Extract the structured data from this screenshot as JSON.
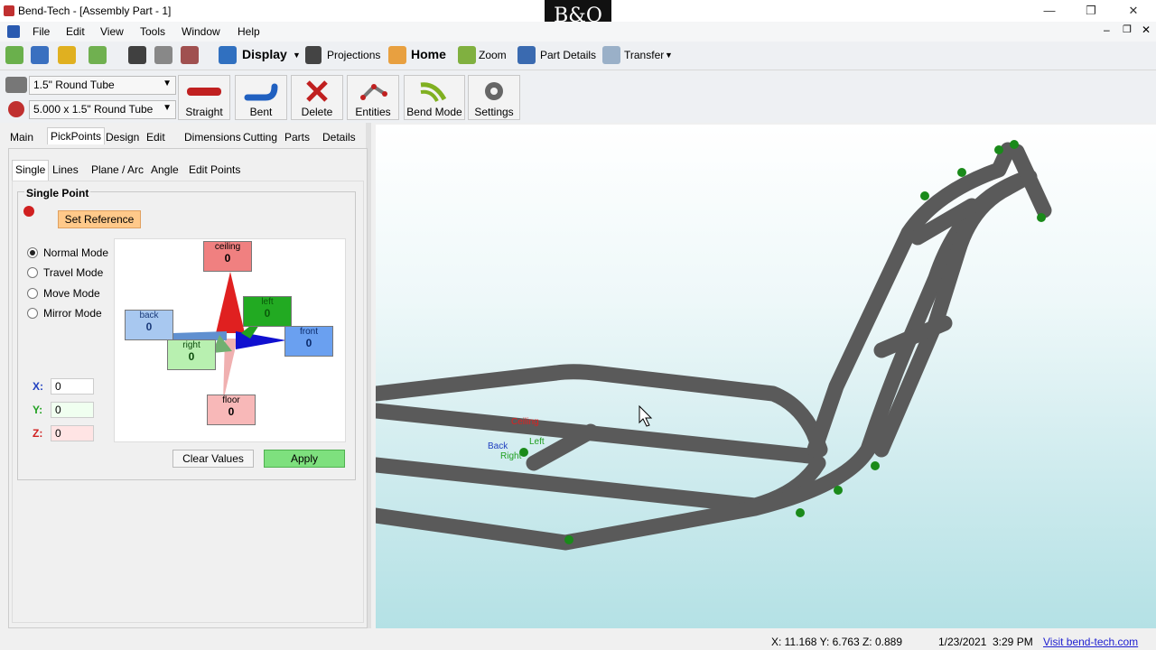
{
  "window": {
    "title": "Bend-Tech - [Assembly Part - 1]",
    "overlay_logo": "B&O"
  },
  "menu": [
    "File",
    "Edit",
    "View",
    "Tools",
    "Window",
    "Help"
  ],
  "toolbar": {
    "display": "Display",
    "projections": "Projections",
    "home": "Home",
    "zoom": "Zoom",
    "part_details": "Part Details",
    "transfer": "Transfer"
  },
  "material": {
    "tube": "1.5\" Round Tube",
    "die": "5.000 x 1.5\" Round Tube"
  },
  "big_buttons": {
    "straight": "Straight",
    "bent": "Bent",
    "delete": "Delete",
    "entities": "Entities",
    "bend_mode": "Bend Mode",
    "settings": "Settings"
  },
  "main_tabs": [
    "Main",
    "PickPoints",
    "Design",
    "Edit",
    "Dimensions",
    "Cutting",
    "Parts",
    "Details"
  ],
  "sub_tabs": [
    "Single",
    "Lines",
    "Plane / Arc",
    "Angle",
    "Edit Points"
  ],
  "single_point": {
    "group_title": "Single Point",
    "set_reference": "Set Reference",
    "modes": [
      "Normal Mode",
      "Travel Mode",
      "Move Mode",
      "Mirror Mode"
    ],
    "selected_mode": "Normal Mode",
    "directions": {
      "ceiling": {
        "label": "ceiling",
        "value": "0"
      },
      "left": {
        "label": "left",
        "value": "0"
      },
      "back": {
        "label": "back",
        "value": "0"
      },
      "front": {
        "label": "front",
        "value": "0"
      },
      "right": {
        "label": "right",
        "value": "0"
      },
      "floor": {
        "label": "floor",
        "value": "0"
      }
    },
    "coords": {
      "x_label": "X:",
      "x": "0",
      "y_label": "Y:",
      "y": "0",
      "z_label": "Z:",
      "z": "0"
    },
    "clear_values": "Clear Values",
    "apply": "Apply"
  },
  "viewport_axis": {
    "back": "Back",
    "left": "Left",
    "right": "Right",
    "ceiling": "Ceiling"
  },
  "status": {
    "coords": "X: 11.168  Y: 6.763  Z: 0.889",
    "date": "1/23/2021",
    "time": "3:29 PM",
    "link": "Visit bend-tech.com"
  },
  "colors": {
    "ceiling": "#f08080",
    "left": "#22aa22",
    "back": "#a8c8f0",
    "front": "#6aa0f0",
    "right": "#b8f0b0",
    "floor": "#f8b8b8",
    "apply": "#7ee07e",
    "set_reference": "#ffc98a",
    "tube": "#5a5a5a",
    "pick_point": "#1a8a1a"
  }
}
